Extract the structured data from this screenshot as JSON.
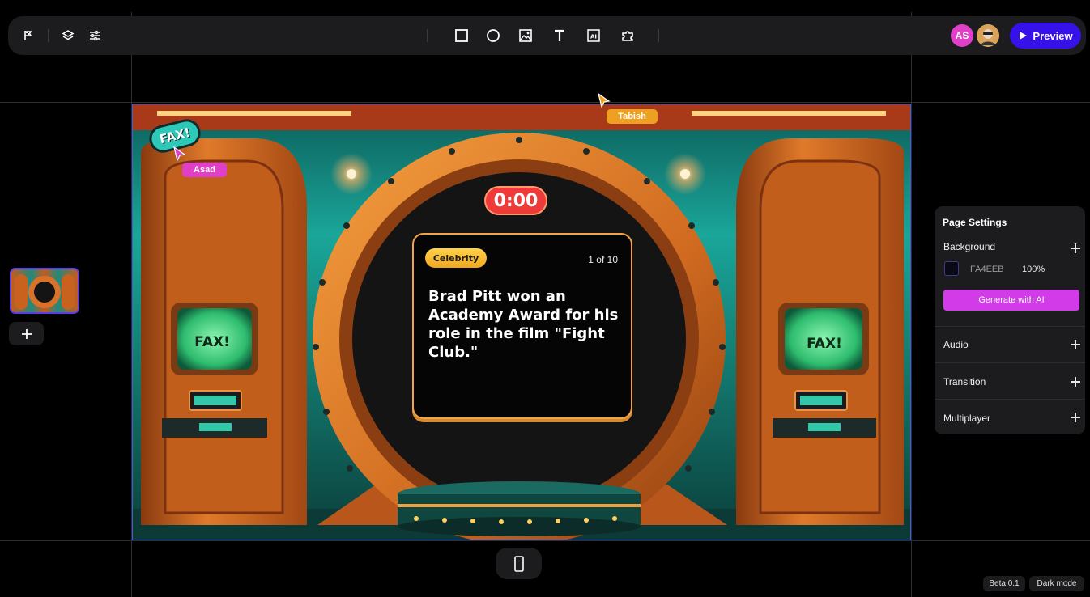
{
  "toolbar": {
    "left_icons": [
      "flag-icon",
      "layers-icon",
      "sliders-icon"
    ],
    "tools": [
      "rectangle-icon",
      "circle-icon",
      "image-icon",
      "text-icon",
      "ai-icon",
      "puzzle-icon"
    ],
    "avatar_initials": "AS",
    "preview_label": "Preview"
  },
  "canvas": {
    "timer": "0:00",
    "card": {
      "category": "Celebrity",
      "counter": "1 of 10",
      "question": "Brad Pitt won an Academy Award for his role in the film \"Fight Club.\""
    },
    "logo_text": "FAX!",
    "screen_text_left": "FAX!",
    "screen_text_right": "FAX!"
  },
  "collaborators": [
    {
      "name": "Asad",
      "color": "#e040c8"
    },
    {
      "name": "Tabish",
      "color": "#f0a020"
    }
  ],
  "page_settings": {
    "title": "Page Settings",
    "background_label": "Background",
    "background_hex": "FA4EEB",
    "background_opacity": "100%",
    "generate_label": "Generate with AI",
    "sections": [
      "Audio",
      "Transition",
      "Multiplayer"
    ]
  },
  "footer": {
    "beta": "Beta 0.1",
    "dark_mode": "Dark mode"
  },
  "colors": {
    "accent": "#3612e8",
    "ai_button": "#d23ce8",
    "canvas_border": "#3a5fd8"
  }
}
